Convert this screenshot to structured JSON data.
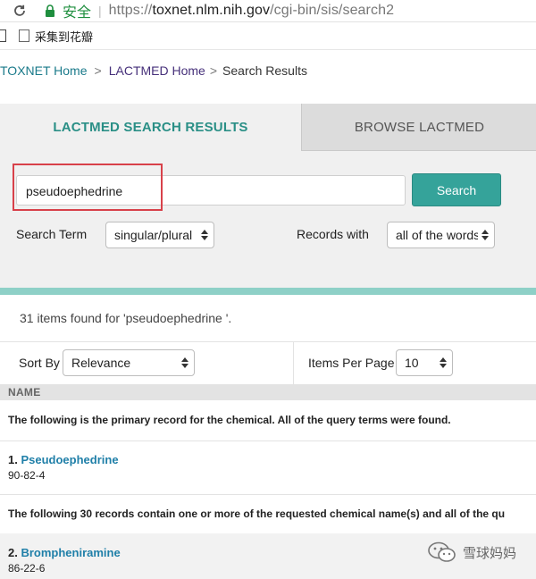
{
  "browser": {
    "secure_label": "安全",
    "url_scheme": "https://",
    "url_host": "toxnet.nlm.nih.gov",
    "url_path": "/cgi-bin/sis/search2"
  },
  "bookmarks": {
    "item_label": "采集到花瓣"
  },
  "breadcrumb": {
    "home": "TOXNET Home",
    "lactmed_home": "LACTMED Home",
    "sep1": ">",
    "sep2": ">",
    "current": "Search Results"
  },
  "tabs": {
    "active": "LACTMED SEARCH RESULTS",
    "inactive": "BROWSE LACTMED"
  },
  "search": {
    "value": "pseudoephedrine",
    "button": "Search",
    "term_label": "Search Term",
    "term_value": "singular/plural",
    "records_label": "Records with",
    "records_value": "all of the words"
  },
  "results": {
    "count_text": "31 items found for 'pseudoephedrine '.",
    "sort_label": "Sort By",
    "sort_value": "Relevance",
    "per_page_label": "Items Per Page",
    "per_page_value": "10",
    "name_header": "NAME",
    "primary_note": "The following is the primary record for the chemical. All of the query terms were found.",
    "secondary_note": "The following 30 records contain one or more of the requested chemical name(s) and all of the qu",
    "records": [
      {
        "number": "1.",
        "name": "Pseudoephedrine",
        "cas": "90-82-4"
      },
      {
        "number": "2.",
        "name": "Brompheniramine",
        "cas": "86-22-6"
      }
    ]
  },
  "watermark": {
    "text": "雪球妈妈"
  },
  "colors": {
    "accent": "#35a39a",
    "tab_active_text": "#2a8f86",
    "link": "#1f7fa8",
    "highlight": "#d8414a"
  }
}
